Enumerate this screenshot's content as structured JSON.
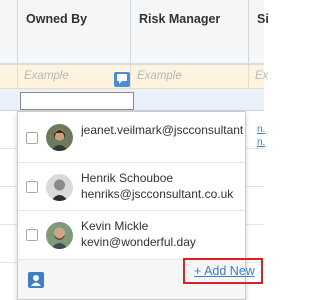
{
  "columns": {
    "owned_by": "Owned By",
    "risk_manager": "Risk Manager",
    "partial": "Sit"
  },
  "filter_row": {
    "owned_by_placeholder": "Example",
    "risk_manager_placeholder": "Example",
    "partial_placeholder": "Ex"
  },
  "edit_input": {
    "value": ""
  },
  "options": [
    {
      "line1": "jeanet.veilmark@jscconsultant.c...",
      "line2": "",
      "avatar": "avatar-photo"
    },
    {
      "line1": "Henrik Schouboe",
      "line2": "henriks@jscconsultant.co.uk",
      "avatar": "avatar-photo"
    },
    {
      "line1": "Kevin Mickle",
      "line2": "kevin@wonderful.day",
      "avatar": "avatar-photo"
    }
  ],
  "footer": {
    "add_new_label": "+ Add New"
  },
  "colors": {
    "accent": "#4a8fd6",
    "link": "#3a7fc8",
    "highlight_border": "#e02020",
    "filter_bg": "#fdf3df"
  }
}
